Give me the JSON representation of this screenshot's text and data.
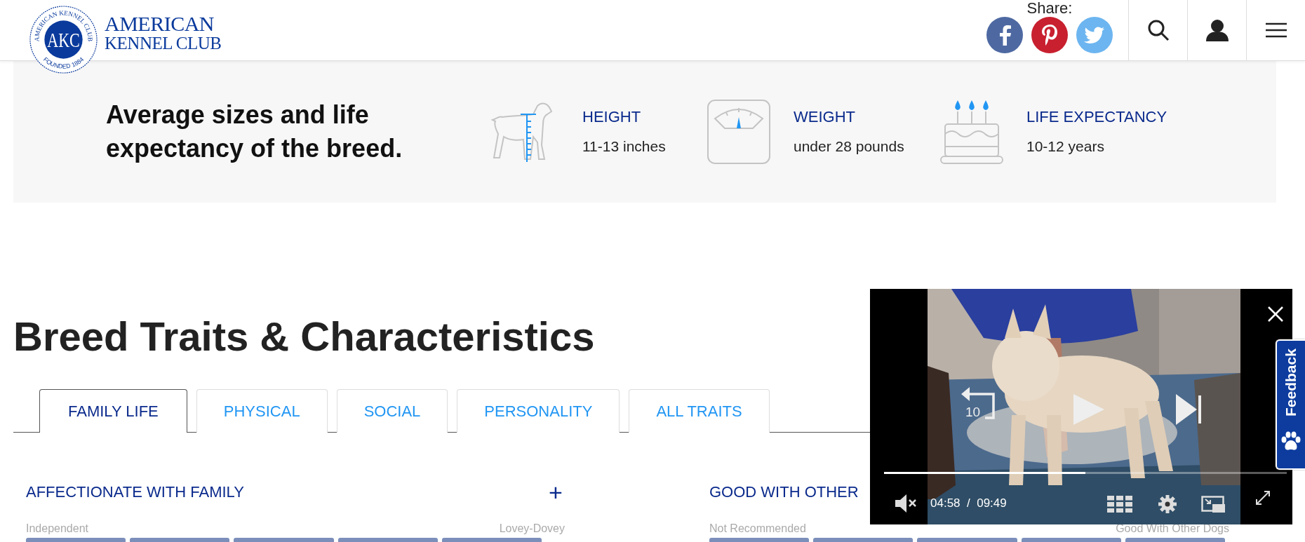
{
  "header": {
    "seal": {
      "letters": "AKC",
      "ring_top": "AMERICAN KENNEL CLUB",
      "ring_bottom": "FOUNDED 1884"
    },
    "wordmark": [
      "AMERICAN",
      "KENNEL CLUB"
    ],
    "share_label": "Share:"
  },
  "stats": {
    "heading": "Average sizes and life expectancy of the breed.",
    "items": [
      {
        "kind": "height",
        "label": "HEIGHT",
        "value": "11-13 inches"
      },
      {
        "kind": "weight",
        "label": "WEIGHT",
        "value": "under 28 pounds"
      },
      {
        "kind": "life",
        "label": "LIFE EXPECTANCY",
        "value": "10-12 years"
      }
    ]
  },
  "section_title": "Breed Traits & Characteristics",
  "tabs": [
    {
      "label": "FAMILY LIFE",
      "selected": true
    },
    {
      "label": "PHYSICAL",
      "selected": false
    },
    {
      "label": "SOCIAL",
      "selected": false
    },
    {
      "label": "PERSONALITY",
      "selected": false
    },
    {
      "label": "ALL TRAITS",
      "selected": false
    }
  ],
  "traits": [
    {
      "title": "AFFECTIONATE WITH FAMILY",
      "toggle": "+",
      "low_label": "Independent",
      "high_label": "Lovey-Dovey"
    },
    {
      "title": "GOOD WITH OTHER",
      "low_label": "Not Recommended",
      "high_label": "Good With Other Dogs"
    }
  ],
  "video": {
    "rewind_label": "10",
    "level": 0.5,
    "muted": true,
    "time": "04:58",
    "separator": "/",
    "duration": "09:49"
  },
  "feedback": {
    "label": "Feedback"
  }
}
